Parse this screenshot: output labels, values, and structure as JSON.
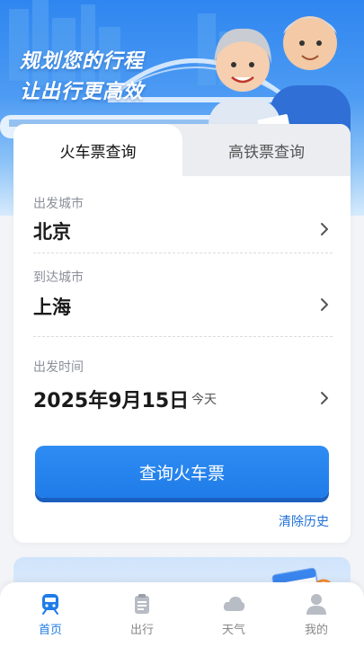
{
  "hero": {
    "title_line1": "规划您的行程",
    "title_line2": "让出行更高效"
  },
  "tabs": [
    {
      "label": "火车票查询",
      "active": true
    },
    {
      "label": "高铁票查询",
      "active": false
    }
  ],
  "form": {
    "departure": {
      "label": "出发城市",
      "value": "北京"
    },
    "arrival": {
      "label": "到达城市",
      "value": "上海"
    },
    "date": {
      "label": "出发时间",
      "value": "2025年9月15日",
      "hint": "今天"
    }
  },
  "actions": {
    "query_button": "查询火车票",
    "clear_history": "清除历史"
  },
  "bottom_nav": [
    {
      "label": "首页",
      "icon": "train-icon",
      "active": true
    },
    {
      "label": "出行",
      "icon": "clipboard-icon",
      "active": false
    },
    {
      "label": "天气",
      "icon": "cloud-icon",
      "active": false
    },
    {
      "label": "我的",
      "icon": "user-icon",
      "active": false
    }
  ],
  "colors": {
    "accent": "#1f7ce8",
    "hero_top": "#2f86f0",
    "inactive_tab_bg": "#ebedf0"
  }
}
